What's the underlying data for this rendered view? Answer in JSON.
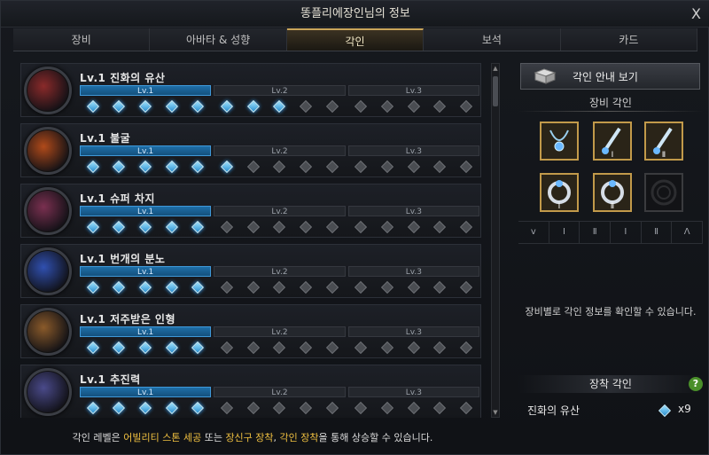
{
  "window": {
    "title": "똥플리에장인님의 정보",
    "close_label": "X"
  },
  "tabs": [
    {
      "label": "장비"
    },
    {
      "label": "아바타 & 성향"
    },
    {
      "label": "각인",
      "active": true
    },
    {
      "label": "보석"
    },
    {
      "label": "카드"
    }
  ],
  "level_labels": [
    "Lv.1",
    "Lv.2",
    "Lv.3"
  ],
  "engravings": [
    {
      "name": "Lv.1 진화의 유산",
      "orb_color": "#8a2a2a",
      "filled": 8
    },
    {
      "name": "Lv.1 불굴",
      "orb_color": "#b04a1a",
      "filled": 6
    },
    {
      "name": "Lv.1 슈퍼 차지",
      "orb_color": "#7a3050",
      "filled": 5
    },
    {
      "name": "Lv.1 번개의 분노",
      "orb_color": "#3050b0",
      "filled": 5
    },
    {
      "name": "Lv.1 저주받은 인형",
      "orb_color": "#8a5a2a",
      "filled": 5
    },
    {
      "name": "Lv.1 추진력",
      "orb_color": "#4a4a8a",
      "filled": 5
    }
  ],
  "footer": {
    "part1": "각인 레벨은 ",
    "hl1": "어빌리티 스톤 세공",
    "part2": " 또는 ",
    "hl2": "장신구 장착",
    "part3": ", ",
    "hl3": "각인 장착",
    "part4": "을 통해 상승할 수 있습니다."
  },
  "right": {
    "guide_label": "각인 안내 보기",
    "equip_engraving_title": "장비 각인",
    "stat_row": [
      "ⅴ",
      "Ⅰ",
      "Ⅱ",
      "Ⅰ",
      "Ⅱ",
      "Λ"
    ],
    "slot_roman": [
      "",
      "Ⅰ",
      "Ⅱ",
      "Ⅰ",
      "Ⅱ",
      ""
    ],
    "hint": "장비별로 각인 정보를 확인할 수 있습니다.",
    "attached_title": "장착 각인",
    "help_label": "?",
    "attached": {
      "name": "진화의 유산",
      "count": "x9"
    }
  },
  "colors": {
    "accent_gold": "#c9a55a",
    "gem_blue": "#2a8fd0",
    "highlight_yellow": "#f0c040"
  }
}
